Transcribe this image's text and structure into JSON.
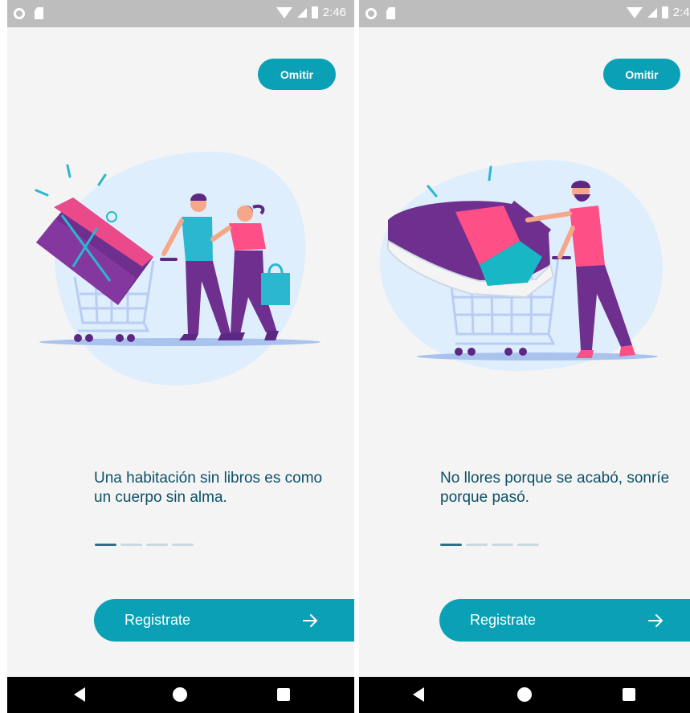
{
  "status_bar": {
    "time": "2:46"
  },
  "screens": [
    {
      "skip_label": "Omitir",
      "quote": "Una habitación sin libros es como un cuerpo sin alma.",
      "page_indicator": {
        "total": 4,
        "active": 1
      },
      "register_label": "Registrate",
      "illustration": "shopping-couple-gift-cart-illustration"
    },
    {
      "skip_label": "Omitir",
      "quote": "No llores porque se acabó, sonríe porque pasó.",
      "page_indicator": {
        "total": 4,
        "active": 1
      },
      "register_label": "Registrate",
      "illustration": "man-pushing-sneaker-cart-illustration"
    }
  ],
  "colors": {
    "accent": "#0aa0b6",
    "quote_text": "#0c5067",
    "indicator_active": "#2e7088",
    "indicator_inactive": "#c9d9e2",
    "background": "#f4f4f4"
  }
}
